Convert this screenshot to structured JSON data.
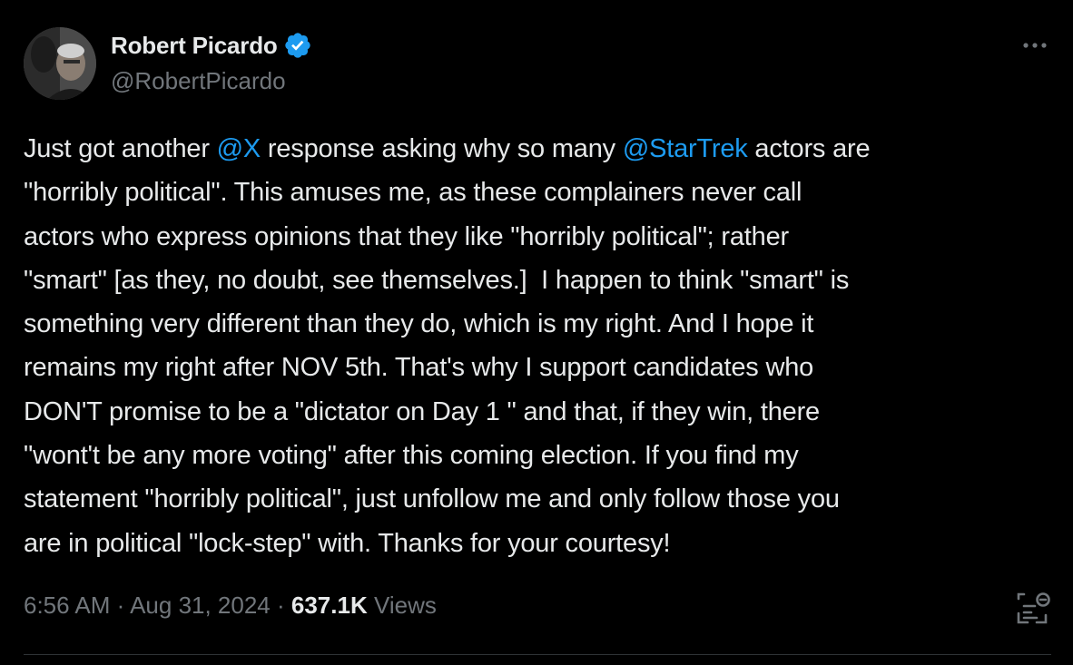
{
  "author": {
    "display_name": "Robert Picardo",
    "handle": "@RobertPicardo",
    "verified": true,
    "avatar_icon": "profile-photo"
  },
  "tweet": {
    "lines": [
      {
        "segments": [
          {
            "text": "Just got another ",
            "type": "text"
          },
          {
            "text": "@X",
            "type": "mention"
          },
          {
            "text": " response asking why so many ",
            "type": "text"
          },
          {
            "text": "@StarTrek",
            "type": "mention"
          },
          {
            "text": " actors are",
            "type": "text"
          }
        ]
      },
      {
        "segments": [
          {
            "text": "\"horribly political\". This amuses me, as these complainers never call",
            "type": "text"
          }
        ]
      },
      {
        "segments": [
          {
            "text": "actors who express opinions that they like \"horribly political\"; rather",
            "type": "text"
          }
        ]
      },
      {
        "segments": [
          {
            "text": "\"smart\" [as they, no doubt, see themselves.]  I happen to think \"smart\" is",
            "type": "text"
          }
        ]
      },
      {
        "segments": [
          {
            "text": "something very different than they do, which is my right. And I hope it",
            "type": "text"
          }
        ]
      },
      {
        "segments": [
          {
            "text": "remains my right after NOV 5th. That's why I support candidates who",
            "type": "text"
          }
        ]
      },
      {
        "segments": [
          {
            "text": "DON'T promise to be a \"dictator on Day 1 \" and that, if they win, there",
            "type": "text"
          }
        ]
      },
      {
        "segments": [
          {
            "text": "\"wont't be any more voting\" after this coming election. If you find my",
            "type": "text"
          }
        ]
      },
      {
        "segments": [
          {
            "text": "statement \"horribly political\", just unfollow me and only follow those you",
            "type": "text"
          }
        ]
      },
      {
        "segments": [
          {
            "text": "are in political \"lock-step\" with. Thanks for your courtesy!",
            "type": "text"
          }
        ]
      }
    ]
  },
  "meta": {
    "time": "6:56 AM",
    "separator": " · ",
    "date": "Aug 31, 2024",
    "views_count": "637.1K",
    "views_label": " Views"
  },
  "colors": {
    "background": "#000000",
    "text": "#e7e9ea",
    "secondary": "#71767b",
    "accent": "#1d9bf0"
  },
  "icons": [
    "verified-badge-icon",
    "more-options-icon",
    "grok-analyze-icon"
  ]
}
